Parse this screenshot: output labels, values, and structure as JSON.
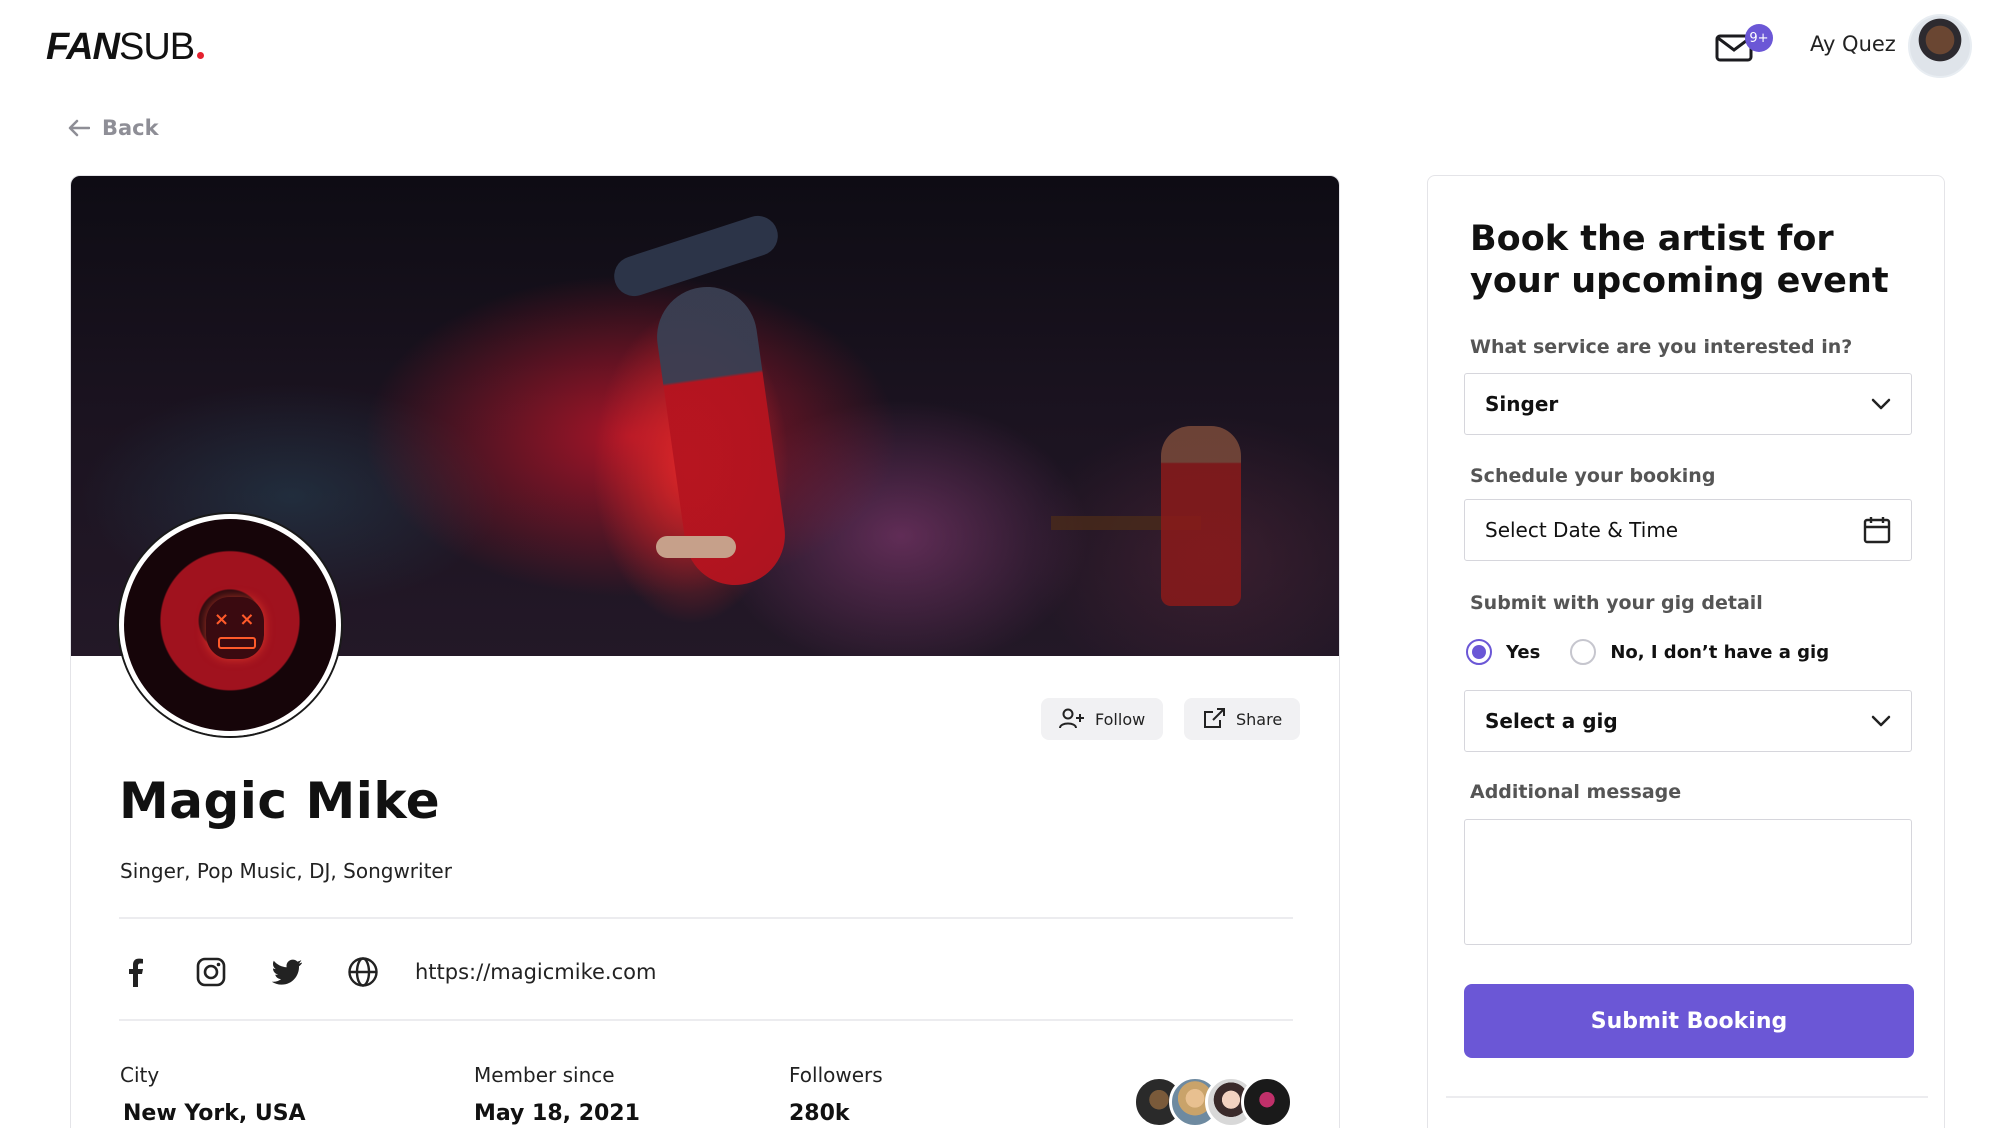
{
  "header": {
    "logo_bold": "FAN",
    "logo_light": "SUB",
    "mail_badge": "9+",
    "user_name": "Ay Quez"
  },
  "nav": {
    "back_label": "Back"
  },
  "profile": {
    "name": "Magic Mike",
    "tags": "Singer, Pop Music, DJ, Songwriter",
    "follow_label": "Follow",
    "share_label": "Share",
    "website": "https://magicmike.com",
    "social_icons": [
      "facebook-icon",
      "instagram-icon",
      "twitter-icon",
      "globe-icon"
    ],
    "stats": {
      "city_label": "City",
      "city_value": "New York, USA",
      "member_label": "Member since",
      "member_value": "May 18, 2021",
      "followers_label": "Followers",
      "followers_value": "280k"
    }
  },
  "booking": {
    "title": "Book the artist for your upcoming event",
    "service_label": "What service are you interested in?",
    "service_value": "Singer",
    "schedule_label": "Schedule your booking",
    "schedule_value": "Select Date & Time",
    "gig_label": "Submit with your gig detail",
    "radio_yes": "Yes",
    "radio_no": "No, I don’t have a gig",
    "radio_selected": "Yes",
    "gig_select_value": "Select a gig",
    "message_label": "Additional message",
    "message_value": "",
    "submit_label": "Submit Booking"
  },
  "colors": {
    "accent": "#6b57d6",
    "logo_dot": "#e5202e"
  }
}
